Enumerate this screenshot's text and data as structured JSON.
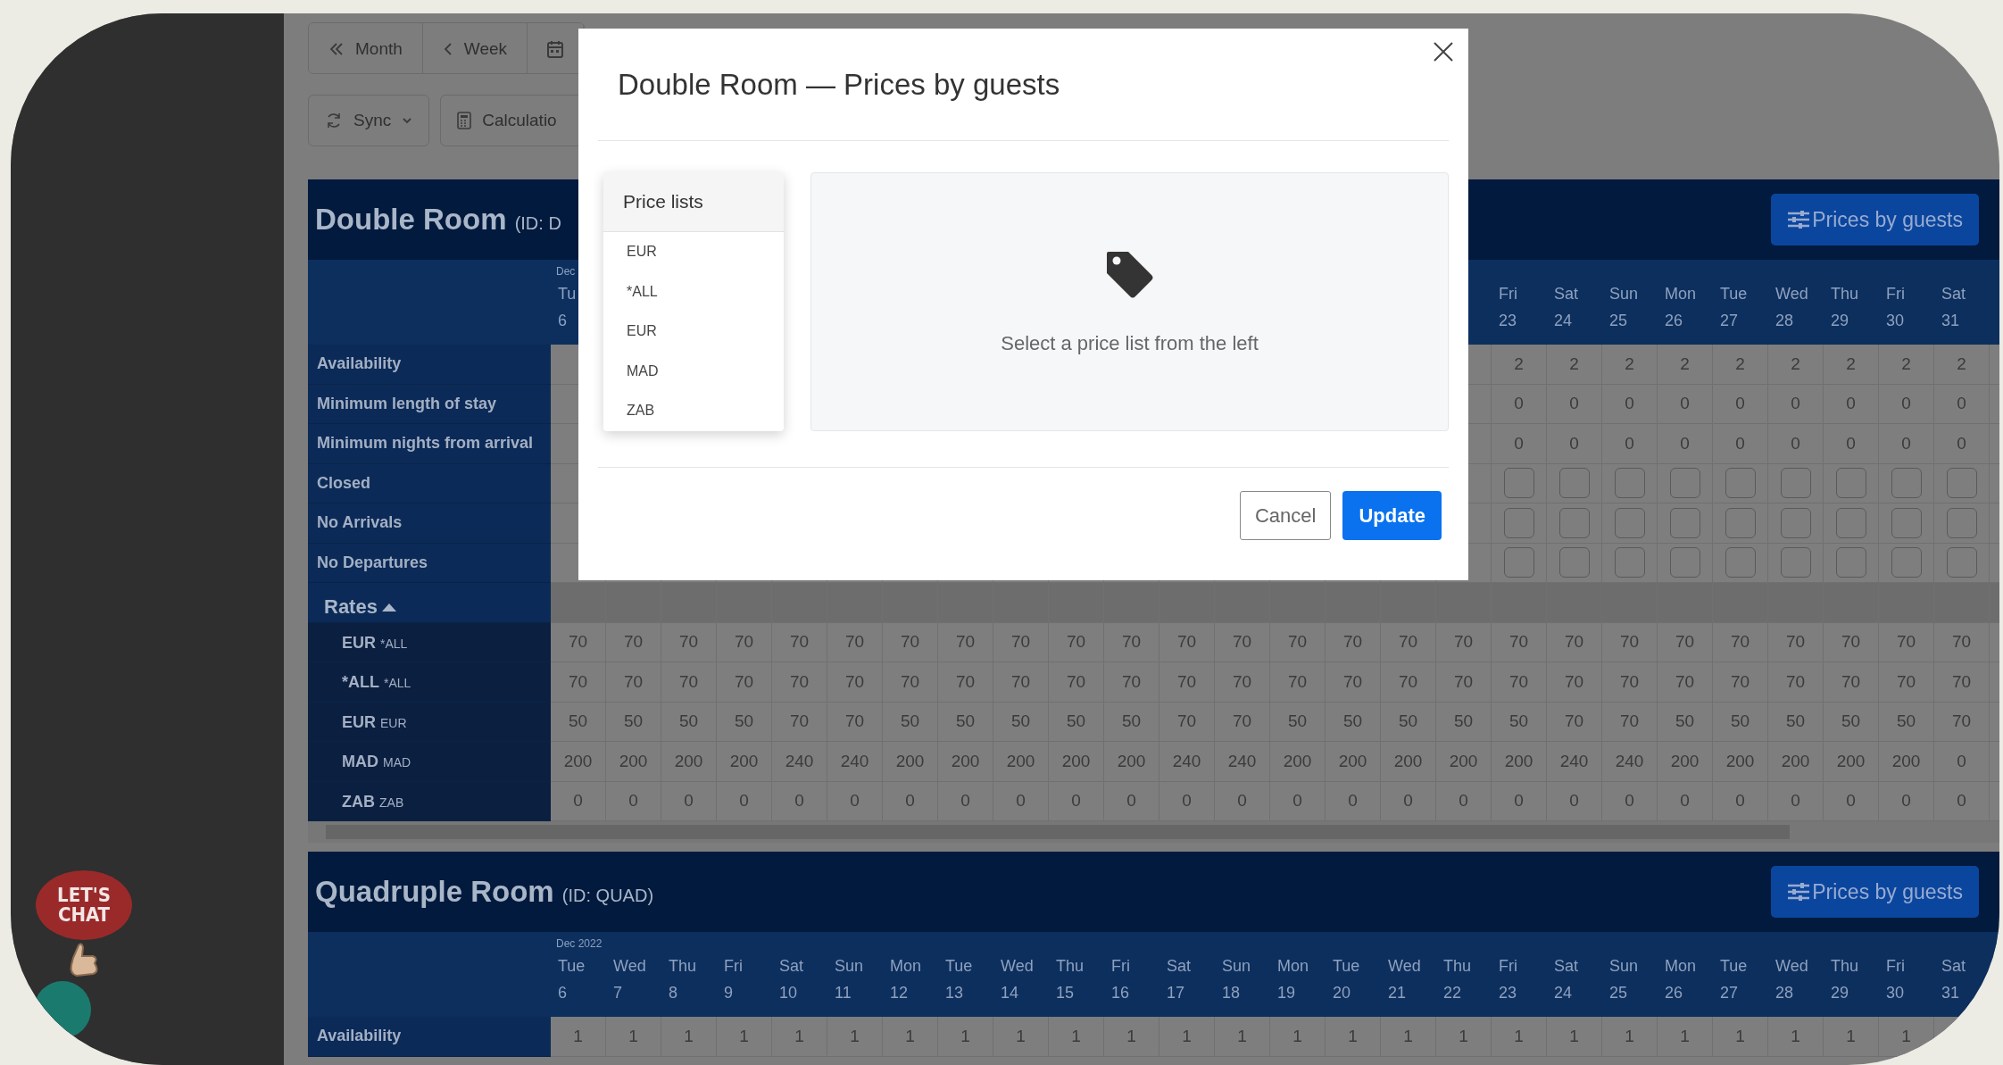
{
  "toolbar_row_1": [
    {
      "kind": "double-left",
      "label": "Month"
    },
    {
      "kind": "left",
      "label": "Week"
    },
    {
      "kind": "calendar"
    }
  ],
  "toolbar_row_2": [
    {
      "kind": "sync",
      "label": "Sync",
      "dropdown": true
    },
    {
      "kind": "calculator",
      "label": "Calculatio",
      "dropdown": false
    }
  ],
  "rooms": [
    {
      "name": "Double Room",
      "id_text": "(ID: D",
      "button": "Prices by guests",
      "month": "Dec",
      "lead_day": {
        "day": "Tu",
        "date": "6"
      },
      "days": [
        {
          "day": "Fri",
          "date": "23"
        },
        {
          "day": "Sat",
          "date": "24"
        },
        {
          "day": "Sun",
          "date": "25"
        },
        {
          "day": "Mon",
          "date": "26"
        },
        {
          "day": "Tue",
          "date": "27"
        },
        {
          "day": "Wed",
          "date": "28"
        },
        {
          "day": "Thu",
          "date": "29"
        },
        {
          "day": "Fri",
          "date": "30"
        },
        {
          "day": "Sat",
          "date": "31"
        }
      ],
      "rows": [
        {
          "kind": "number",
          "label": "Availability",
          "values": [
            "2",
            "2",
            "2",
            "2",
            "2",
            "2",
            "2",
            "2",
            "2"
          ]
        },
        {
          "kind": "number",
          "label": "Minimum length of stay",
          "values": [
            "0",
            "0",
            "0",
            "0",
            "0",
            "0",
            "0",
            "0",
            "0"
          ]
        },
        {
          "kind": "number",
          "label": "Minimum nights from arrival",
          "values": [
            "0",
            "0",
            "0",
            "0",
            "0",
            "0",
            "0",
            "0",
            "0"
          ]
        },
        {
          "kind": "checkbox",
          "label": "Closed",
          "checked": [
            false,
            false,
            false,
            false,
            false,
            false,
            false,
            false,
            false
          ]
        },
        {
          "kind": "checkbox",
          "label": "No Arrivals",
          "checked": [
            false,
            false,
            false,
            false,
            false,
            false,
            false,
            false,
            false
          ]
        },
        {
          "kind": "checkbox",
          "label": "No Departures",
          "checked": [
            false,
            false,
            false,
            false,
            false,
            false,
            false,
            false,
            false
          ]
        }
      ],
      "rates_label": "Rates",
      "rates_expanded": true,
      "rates": [
        {
          "name": "EUR",
          "code": "*ALL",
          "values": [
            "70",
            "70",
            "70",
            "70",
            "70",
            "70",
            "70",
            "70",
            "70",
            "70",
            "70",
            "70",
            "70",
            "70",
            "70",
            "70",
            "70",
            "70",
            "70",
            "70",
            "70",
            "70",
            "70",
            "70",
            "70",
            "70"
          ]
        },
        {
          "name": "*ALL",
          "code": "*ALL",
          "values": [
            "70",
            "70",
            "70",
            "70",
            "70",
            "70",
            "70",
            "70",
            "70",
            "70",
            "70",
            "70",
            "70",
            "70",
            "70",
            "70",
            "70",
            "70",
            "70",
            "70",
            "70",
            "70",
            "70",
            "70",
            "70",
            "70"
          ]
        },
        {
          "name": "EUR",
          "code": "EUR",
          "values": [
            "50",
            "50",
            "50",
            "50",
            "70",
            "70",
            "50",
            "50",
            "50",
            "50",
            "50",
            "70",
            "70",
            "50",
            "50",
            "50",
            "50",
            "50",
            "70",
            "70",
            "50",
            "50",
            "50",
            "50",
            "50",
            "70"
          ]
        },
        {
          "name": "MAD",
          "code": "MAD",
          "values": [
            "200",
            "200",
            "200",
            "200",
            "240",
            "240",
            "200",
            "200",
            "200",
            "200",
            "200",
            "240",
            "240",
            "200",
            "200",
            "200",
            "200",
            "200",
            "240",
            "240",
            "200",
            "200",
            "200",
            "200",
            "200",
            "0"
          ]
        },
        {
          "name": "ZAB",
          "code": "ZAB",
          "values": [
            "0",
            "0",
            "0",
            "0",
            "0",
            "0",
            "0",
            "0",
            "0",
            "0",
            "0",
            "0",
            "0",
            "0",
            "0",
            "0",
            "0",
            "0",
            "0",
            "0",
            "0",
            "0",
            "0",
            "0",
            "0",
            "0"
          ]
        }
      ]
    },
    {
      "name": "Quadruple Room",
      "id_text": "(ID: QUAD)",
      "button": "Prices by guests",
      "month": "Dec 2022",
      "days": [
        {
          "day": "Tue",
          "date": "6"
        },
        {
          "day": "Wed",
          "date": "7"
        },
        {
          "day": "Thu",
          "date": "8"
        },
        {
          "day": "Fri",
          "date": "9"
        },
        {
          "day": "Sat",
          "date": "10"
        },
        {
          "day": "Sun",
          "date": "11"
        },
        {
          "day": "Mon",
          "date": "12"
        },
        {
          "day": "Tue",
          "date": "13"
        },
        {
          "day": "Wed",
          "date": "14"
        },
        {
          "day": "Thu",
          "date": "15"
        },
        {
          "day": "Fri",
          "date": "16"
        },
        {
          "day": "Sat",
          "date": "17"
        },
        {
          "day": "Sun",
          "date": "18"
        },
        {
          "day": "Mon",
          "date": "19"
        },
        {
          "day": "Tue",
          "date": "20"
        },
        {
          "day": "Wed",
          "date": "21"
        },
        {
          "day": "Thu",
          "date": "22"
        },
        {
          "day": "Fri",
          "date": "23"
        },
        {
          "day": "Sat",
          "date": "24"
        },
        {
          "day": "Sun",
          "date": "25"
        },
        {
          "day": "Mon",
          "date": "26"
        },
        {
          "day": "Tue",
          "date": "27"
        },
        {
          "day": "Wed",
          "date": "28"
        },
        {
          "day": "Thu",
          "date": "29"
        },
        {
          "day": "Fri",
          "date": "30"
        },
        {
          "day": "Sat",
          "date": "31"
        }
      ],
      "rows": [
        {
          "kind": "number",
          "label": "Availability",
          "values": [
            "1",
            "1",
            "1",
            "1",
            "1",
            "1",
            "1",
            "1",
            "1",
            "1",
            "1",
            "1",
            "1",
            "1",
            "1",
            "1",
            "1",
            "1",
            "1",
            "1",
            "1",
            "1",
            "1",
            "1",
            "1"
          ]
        }
      ]
    }
  ],
  "modal": {
    "title": "Double Room — Prices by guests",
    "list_title": "Price lists",
    "price_lists": [
      "EUR",
      "*ALL",
      "EUR",
      "MAD",
      "ZAB"
    ],
    "empty_text": "Select a price list from the left",
    "cancel": "Cancel",
    "update": "Update"
  },
  "chat_badge": "LET'S CHAT"
}
